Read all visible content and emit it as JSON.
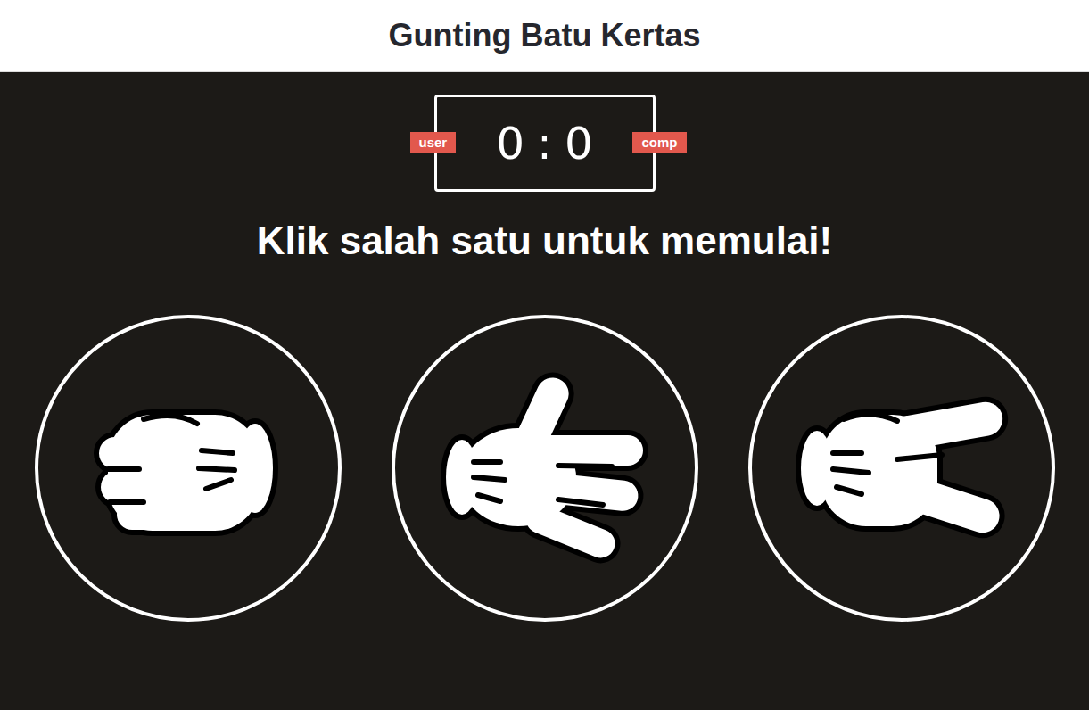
{
  "header": {
    "title": "Gunting Batu Kertas"
  },
  "scoreboard": {
    "user_label": "user",
    "comp_label": "comp",
    "user_score": "0",
    "separator": ":",
    "comp_score": "0"
  },
  "message": "Klik salah satu untuk memulai!",
  "choices": [
    {
      "kind": "rock"
    },
    {
      "kind": "paper"
    },
    {
      "kind": "scissors"
    }
  ]
}
